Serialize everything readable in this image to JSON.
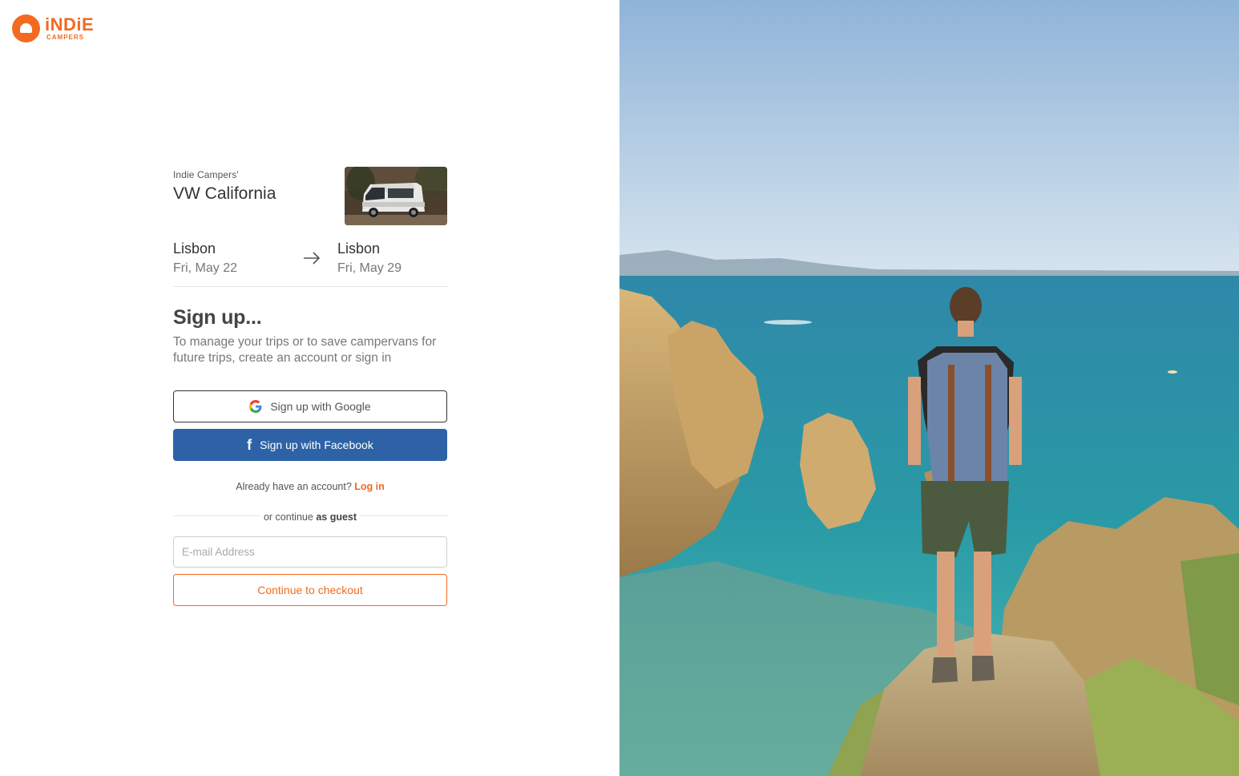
{
  "brand": {
    "logo_word": "iNDiE",
    "logo_sub": "CAMPERS",
    "accent_color": "#f26a21",
    "facebook_color": "#2d63a6"
  },
  "vehicle": {
    "owner": "Indie Campers'",
    "name": "VW California",
    "image": "vw-california-van-photo"
  },
  "route": {
    "pickup": {
      "city": "Lisbon",
      "date": "Fri, May 22"
    },
    "dropoff": {
      "city": "Lisbon",
      "date": "Fri, May 29"
    },
    "arrow_icon": "arrow-right-icon"
  },
  "signup": {
    "title": "Sign up...",
    "subtitle": "To manage your trips or to save campervans for future trips, create an account or sign in",
    "google_label": "Sign up with Google",
    "facebook_label": "Sign up with Facebook"
  },
  "login": {
    "prompt": "Already have an account?",
    "link_label": "Log in"
  },
  "guest": {
    "divider_prefix": "or continue",
    "divider_strong": "as guest",
    "email_placeholder": "E-mail Address",
    "email_value": "",
    "checkout_label": "Continue to checkout"
  },
  "hero_image": "hiker-with-backpack-overlooking-sea-cliffs"
}
